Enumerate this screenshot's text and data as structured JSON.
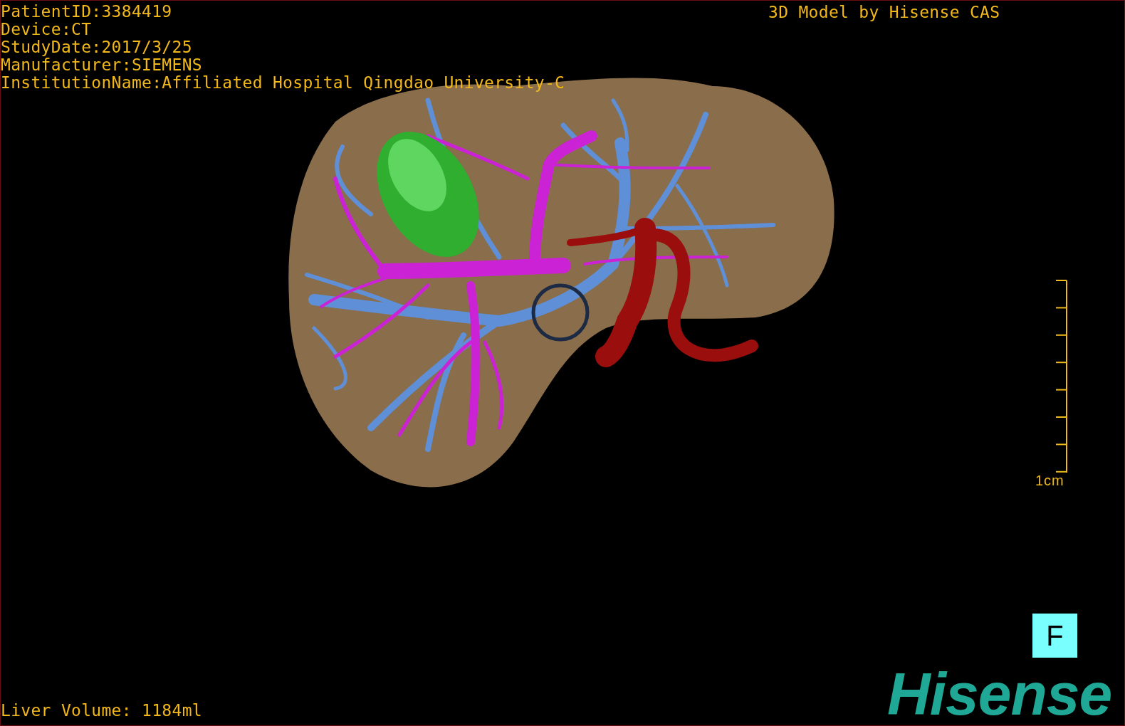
{
  "info_lines": [
    "PatientID:3384419",
    "Device:CT",
    "StudyDate:2017/3/25",
    "Manufacturer:SIEMENS",
    "InstitutionName:Affiliated Hospital Qingdao University-C"
  ],
  "model_title": "3D Model by Hisense CAS",
  "scale_bar": {
    "label": "1cm"
  },
  "orientation_marker": "F",
  "liver_volume": "Liver Volume: 1184ml",
  "logo": "Hisense"
}
